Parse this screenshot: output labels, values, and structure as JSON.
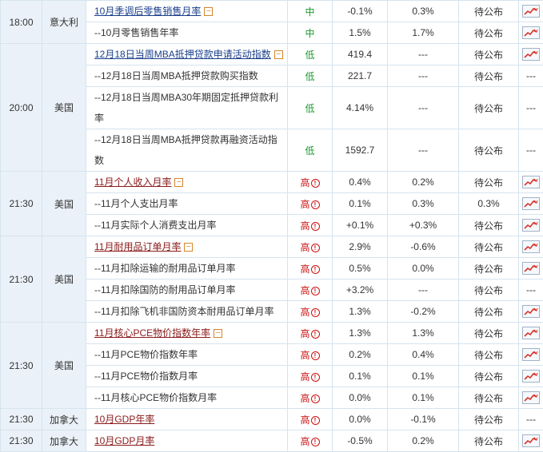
{
  "rows": [
    {
      "time": "18:00",
      "country": "意大利",
      "event": "10月季调后零售销售月率",
      "main": true,
      "link": "blue",
      "importance": "中",
      "imp_class": "mid",
      "previous": "-0.1%",
      "forecast": "0.3%",
      "actual": "待公布",
      "chart": true
    },
    {
      "event": "--10月零售销售年率",
      "importance": "中",
      "imp_class": "mid",
      "previous": "1.5%",
      "forecast": "1.7%",
      "actual": "待公布",
      "chart": true
    },
    {
      "time": "20:00",
      "country": "美国",
      "event": "12月18日当周MBA抵押贷款申请活动指数",
      "main": true,
      "link": "blue",
      "importance": "低",
      "imp_class": "low",
      "previous": "419.4",
      "forecast": "---",
      "actual": "待公布",
      "chart": true
    },
    {
      "event": "--12月18日当周MBA抵押贷款购买指数",
      "importance": "低",
      "imp_class": "low",
      "previous": "221.7",
      "forecast": "---",
      "actual": "待公布",
      "chart": false
    },
    {
      "event": "--12月18日当周MBA30年期固定抵押贷款利率",
      "importance": "低",
      "imp_class": "low",
      "previous": "4.14%",
      "forecast": "---",
      "actual": "待公布",
      "chart": false
    },
    {
      "event": "--12月18日当周MBA抵押贷款再融资活动指数",
      "importance": "低",
      "imp_class": "low",
      "previous": "1592.7",
      "forecast": "---",
      "actual": "待公布",
      "chart": false
    },
    {
      "time": "21:30",
      "country": "美国",
      "event": "11月个人收入月率",
      "main": true,
      "link": "red",
      "importance": "高",
      "imp_class": "high",
      "previous": "0.4%",
      "forecast": "0.2%",
      "actual": "待公布",
      "chart": true
    },
    {
      "event": "--11月个人支出月率",
      "importance": "高",
      "imp_class": "high",
      "previous": "0.1%",
      "forecast": "0.3%",
      "actual": "0.3%",
      "chart": true
    },
    {
      "event": "--11月实际个人消费支出月率",
      "importance": "高",
      "imp_class": "high",
      "previous": "+0.1%",
      "forecast": "+0.3%",
      "actual": "待公布",
      "chart": true
    },
    {
      "time": "21:30",
      "country": "美国",
      "event": "11月耐用品订单月率",
      "main": true,
      "link": "red",
      "importance": "高",
      "imp_class": "high",
      "previous": "2.9%",
      "forecast": "-0.6%",
      "actual": "待公布",
      "chart": true
    },
    {
      "event": "--11月扣除运输的耐用品订单月率",
      "importance": "高",
      "imp_class": "high",
      "previous": "0.5%",
      "forecast": "0.0%",
      "actual": "待公布",
      "chart": true
    },
    {
      "event": "--11月扣除国防的耐用品订单月率",
      "importance": "高",
      "imp_class": "high",
      "previous": "+3.2%",
      "forecast": "---",
      "actual": "待公布",
      "chart": false
    },
    {
      "event": "--11月扣除飞机非国防资本耐用品订单月率",
      "importance": "高",
      "imp_class": "high",
      "previous": "1.3%",
      "forecast": "-0.2%",
      "actual": "待公布",
      "chart": true
    },
    {
      "time": "21:30",
      "country": "美国",
      "event": "11月核心PCE物价指数年率",
      "main": true,
      "link": "red",
      "importance": "高",
      "imp_class": "high",
      "previous": "1.3%",
      "forecast": "1.3%",
      "actual": "待公布",
      "chart": true
    },
    {
      "event": "--11月PCE物价指数年率",
      "importance": "高",
      "imp_class": "high",
      "previous": "0.2%",
      "forecast": "0.4%",
      "actual": "待公布",
      "chart": true
    },
    {
      "event": "--11月PCE物价指数月率",
      "importance": "高",
      "imp_class": "high",
      "previous": "0.1%",
      "forecast": "0.1%",
      "actual": "待公布",
      "chart": true
    },
    {
      "event": "--11月核心PCE物价指数月率",
      "importance": "高",
      "imp_class": "high",
      "previous": "0.0%",
      "forecast": "0.1%",
      "actual": "待公布",
      "chart": true
    },
    {
      "time": "21:30",
      "country": "加拿大",
      "event": "10月GDP年率",
      "main": true,
      "link": "red",
      "toggle": false,
      "importance": "高",
      "imp_class": "high",
      "previous": "0.0%",
      "forecast": "-0.1%",
      "actual": "待公布",
      "chart": false
    },
    {
      "time": "21:30",
      "country": "加拿大",
      "event": "10月GDP月率",
      "main": true,
      "link": "red",
      "toggle": false,
      "importance": "高",
      "imp_class": "high",
      "previous": "-0.5%",
      "forecast": "0.2%",
      "actual": "待公布",
      "chart": true
    }
  ],
  "symbols": {
    "toggle": "−",
    "alert": "!",
    "no_chart": "---"
  },
  "colors": {
    "high": "#cc1111",
    "low": "#1a9a2a",
    "border": "#d6e3ee",
    "label_bg": "#eaf1f8"
  }
}
